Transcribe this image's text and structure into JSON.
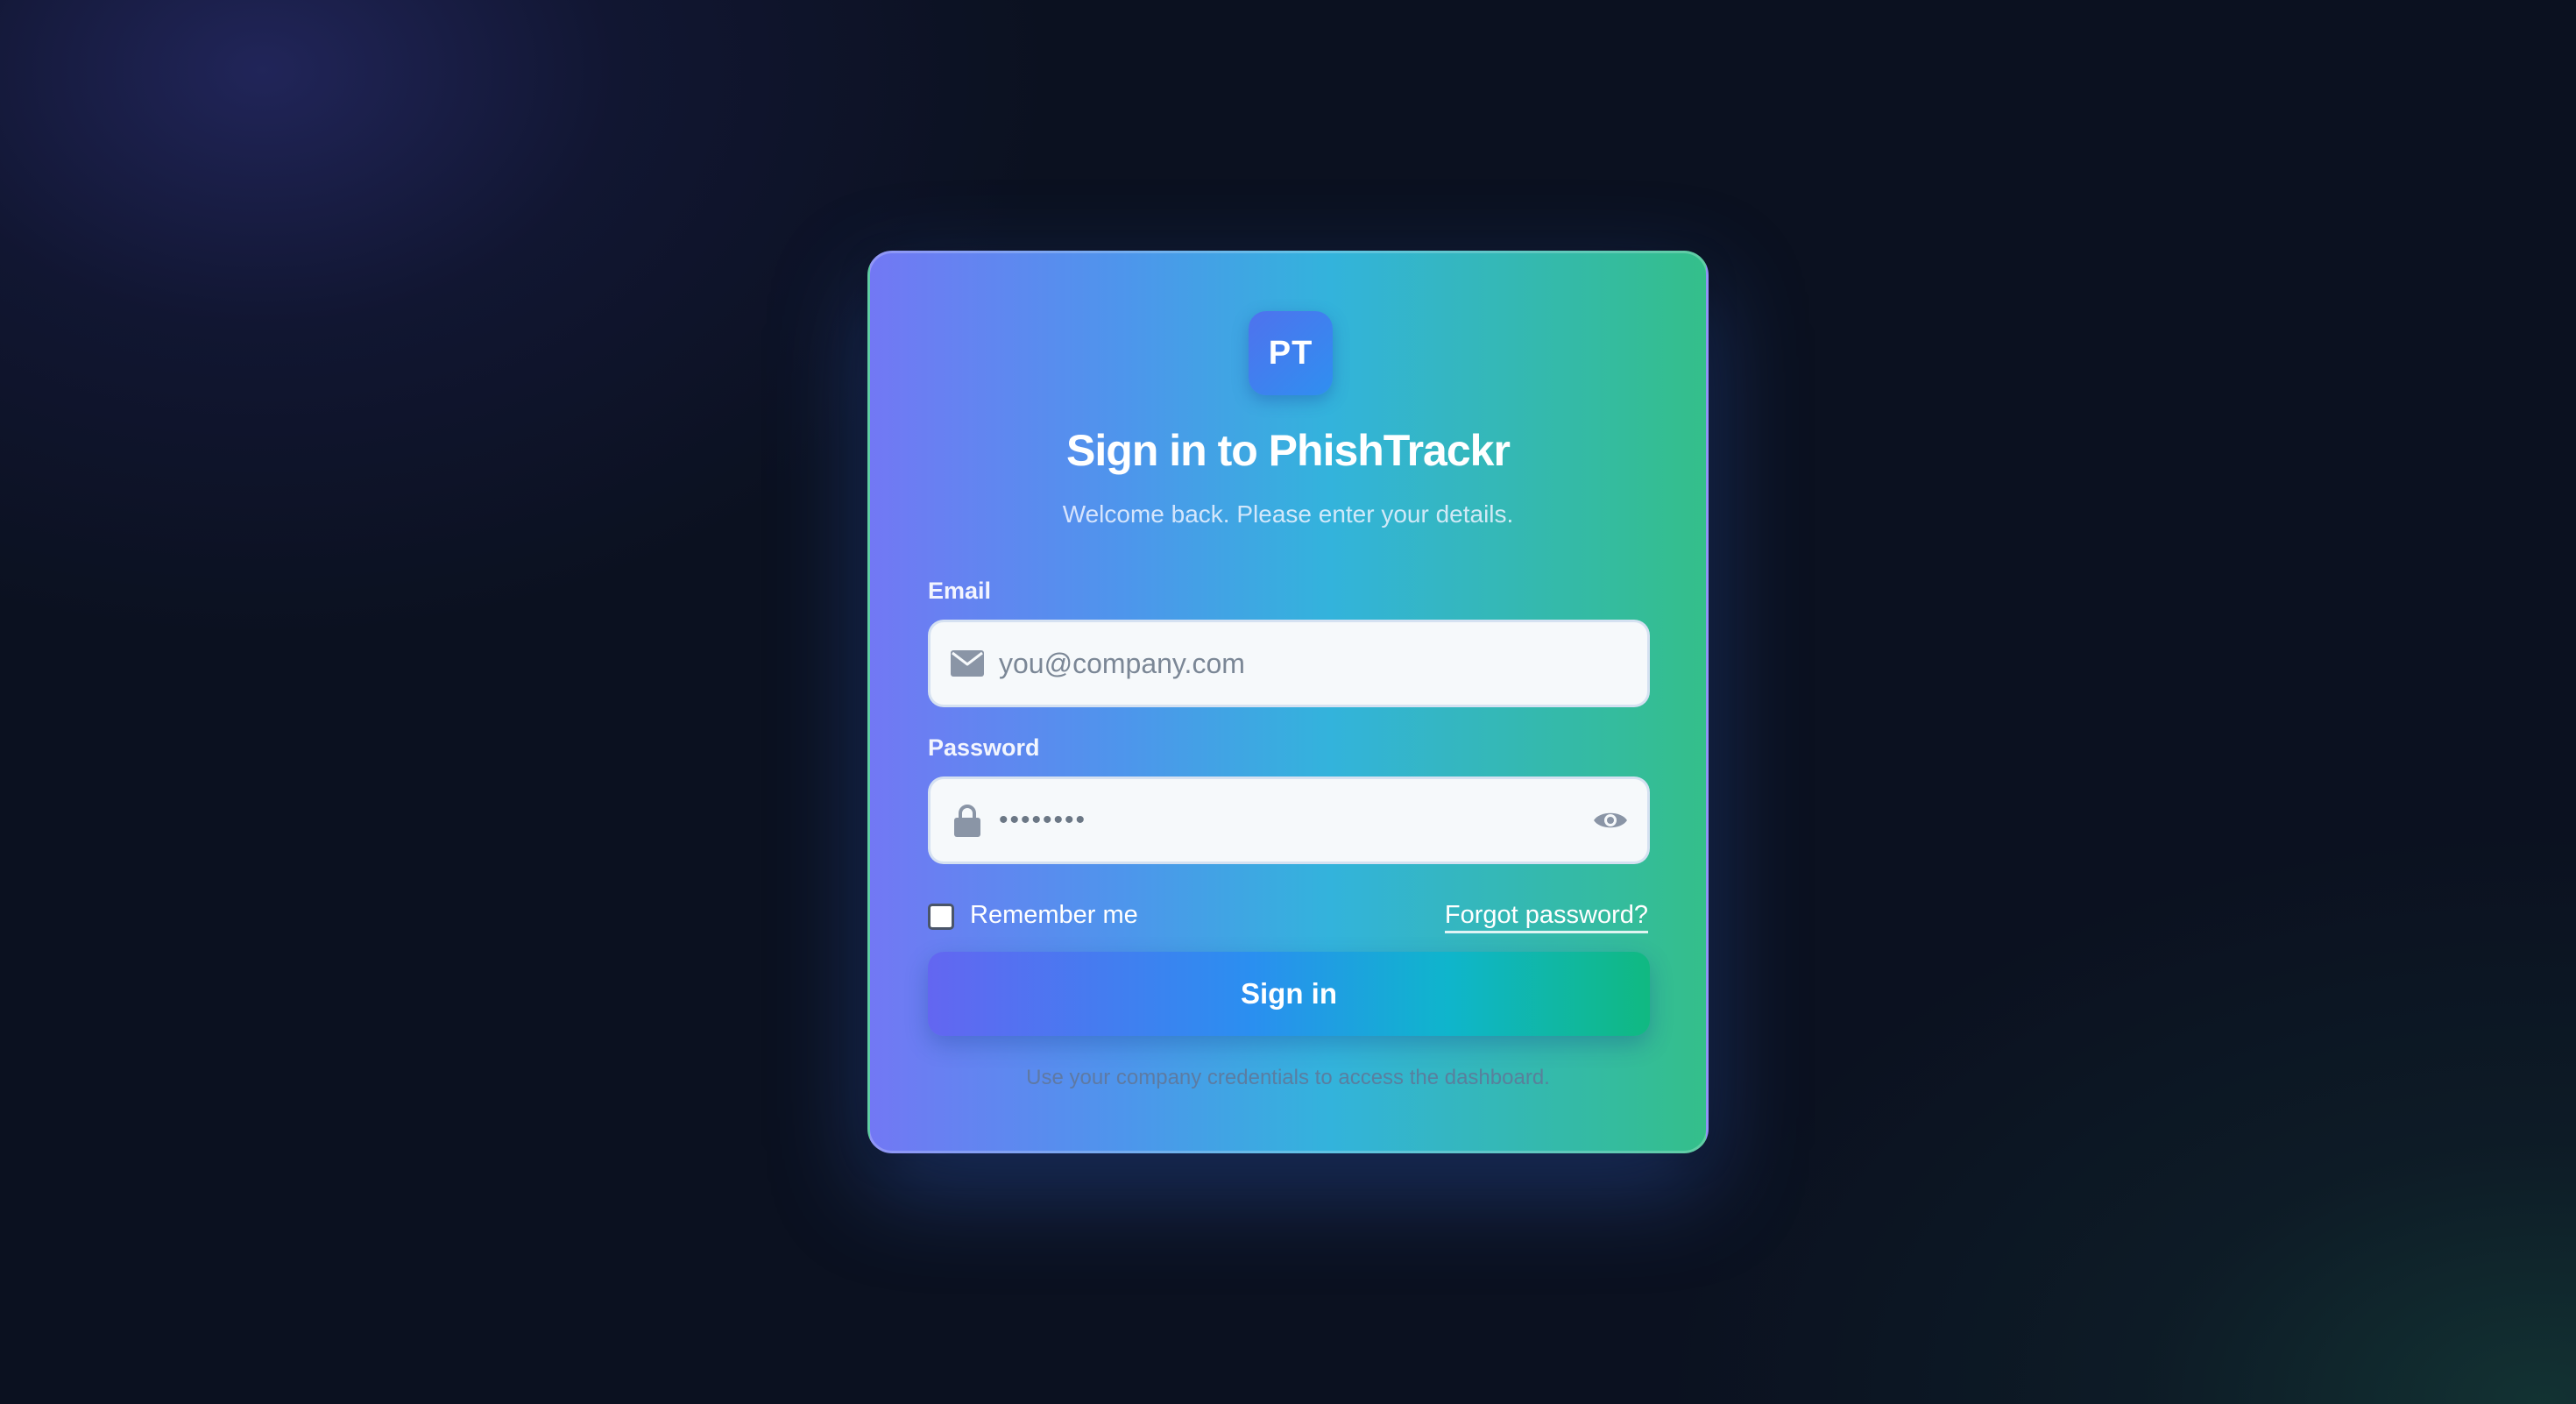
{
  "logo": {
    "initials": "PT"
  },
  "header": {
    "title": "Sign in to PhishTrackr",
    "subtitle": "Welcome back. Please enter your details."
  },
  "form": {
    "email": {
      "label": "Email",
      "placeholder": "you@company.com",
      "value": "",
      "icon": "envelope-icon"
    },
    "password": {
      "label": "Password",
      "value": "••••••••",
      "icon": "lock-icon",
      "toggle_icon": "eye-icon"
    },
    "remember_me": {
      "label": "Remember me",
      "checked": false
    },
    "forgot_password": "Forgot password?",
    "submit_label": "Sign in"
  },
  "footer": {
    "note": "Use your company credentials to access the dashboard."
  },
  "colors": {
    "page_background": "#0b1120",
    "card_gradient_start": "#7278f4",
    "card_gradient_end": "#34bf8a",
    "button_gradient_start": "#6366f1",
    "button_gradient_end": "#10b981"
  }
}
